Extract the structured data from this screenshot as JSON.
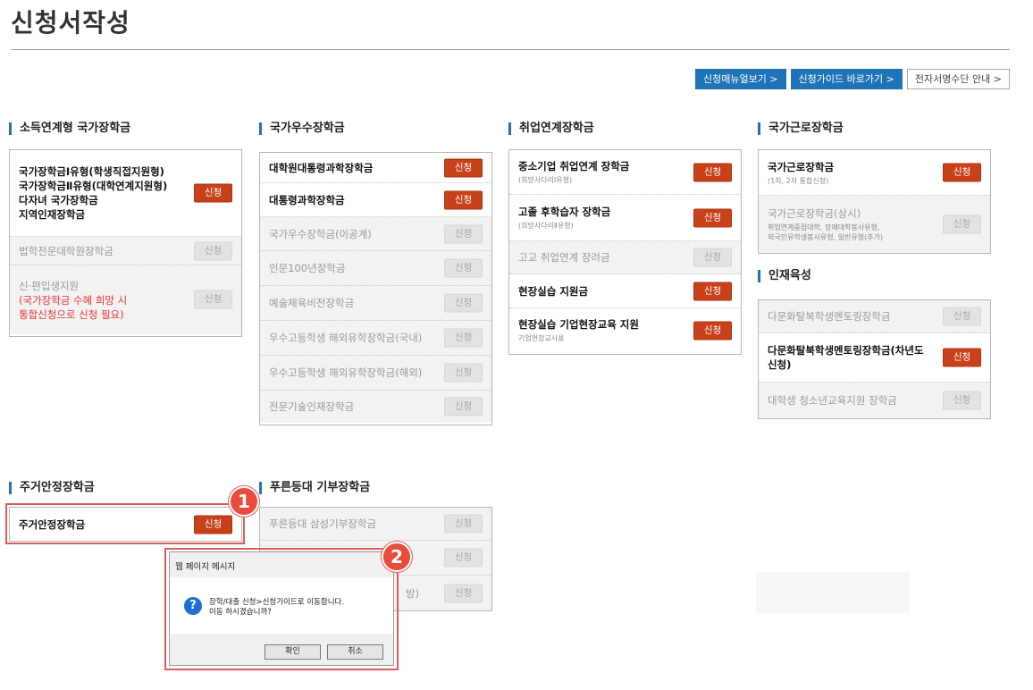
{
  "page": {
    "title": "신청서작성"
  },
  "top_buttons": [
    {
      "label": "신청매뉴얼보기 >",
      "style": "blue"
    },
    {
      "label": "신청가이드 바로가기 >",
      "style": "blue"
    },
    {
      "label": "전자서명수단 안내 >",
      "style": "gray"
    }
  ],
  "apply_label": "신청",
  "sections": {
    "income": {
      "title": "소득연계형 국가장학금",
      "items": [
        {
          "lines": [
            "국가장학금Ⅰ유형(학생직접지원형)",
            "국가장학금Ⅱ유형(대학연계지원형)",
            "다자녀 국가장학금",
            "지역인재장학금"
          ],
          "enabled": true
        },
        {
          "lines": [
            "법학전문대학원장학금"
          ],
          "enabled": false
        },
        {
          "lines": [
            "신·편입생지원"
          ],
          "note": [
            "(국가장학금 수혜 희망 시",
            "통합신청으로 신청 필요)"
          ],
          "enabled": false
        }
      ]
    },
    "excellence": {
      "title": "국가우수장학금",
      "items": [
        {
          "label": "대학원대통령과학장학금",
          "enabled": true
        },
        {
          "label": "대통령과학장학금",
          "enabled": true
        },
        {
          "label": "국가우수장학금(이공계)",
          "enabled": false
        },
        {
          "label": "인문100년장학금",
          "enabled": false
        },
        {
          "label": "예술체육비전장학금",
          "enabled": false
        },
        {
          "label": "우수고등학생 해외유학장학금(국내)",
          "enabled": false
        },
        {
          "label": "우수고등학생 해외유학장학금(해외)",
          "enabled": false
        },
        {
          "label": "전문기술인재장학금",
          "enabled": false
        }
      ]
    },
    "employment": {
      "title": "취업연계장학금",
      "items": [
        {
          "label": "중소기업 취업연계 장학금",
          "sub": "(희망사다리Ⅰ유형)",
          "enabled": true
        },
        {
          "label": "고졸 후학습자 장학금",
          "sub": "(희망사다리Ⅱ유형)",
          "enabled": true
        },
        {
          "label": "고교 취업연계 장려금",
          "enabled": false
        },
        {
          "label": "현장실습 지원금",
          "enabled": true
        },
        {
          "label": "현장실습 기업현장교육 지원",
          "sub": "기업현장교사용",
          "enabled": true
        }
      ]
    },
    "work": {
      "title": "국가근로장학금",
      "items": [
        {
          "label": "국가근로장학금",
          "sub": "(1차, 2차 통합신청)",
          "enabled": true
        },
        {
          "label": "국가근로장학금(상시)",
          "sub": "취업연계중점대학, 장애대학봉사유형,",
          "sub2": "외국인유학생봉사유형, 일반유형(추가)",
          "enabled": false
        }
      ]
    },
    "talent": {
      "title": "인재육성",
      "items": [
        {
          "label": "다문화탈북학생멘토링장학금",
          "enabled": false
        },
        {
          "label": "다문화탈북학생멘토링장학금(차년도",
          "label2": "신청)",
          "enabled": true
        },
        {
          "label": "대학생 청소년교육지원 장학금",
          "enabled": false
        }
      ]
    },
    "housing": {
      "title": "주거안정장학금",
      "items": [
        {
          "label": "주거안정장학금",
          "enabled": true
        }
      ]
    },
    "donation": {
      "title": "푸른등대 기부장학금",
      "items": [
        {
          "label": "푸른등대 삼성기부장학금",
          "enabled": false
        },
        {
          "label": "",
          "enabled": false
        },
        {
          "label": "방)",
          "enabled": false
        }
      ]
    }
  },
  "annotations": {
    "badge1": "1",
    "badge2": "2"
  },
  "dialog": {
    "title": "웹 페이지 메시지",
    "icon": "question-icon",
    "message_line1": "장학/대출 신청>신청가이드로 이동합니다.",
    "message_line2": "이동 하시겠습니까?",
    "ok_label": "확인",
    "cancel_label": "취소"
  },
  "colors": {
    "accent": "#1f73b7",
    "apply": "#c8411a",
    "highlight": "#e05a5a"
  }
}
